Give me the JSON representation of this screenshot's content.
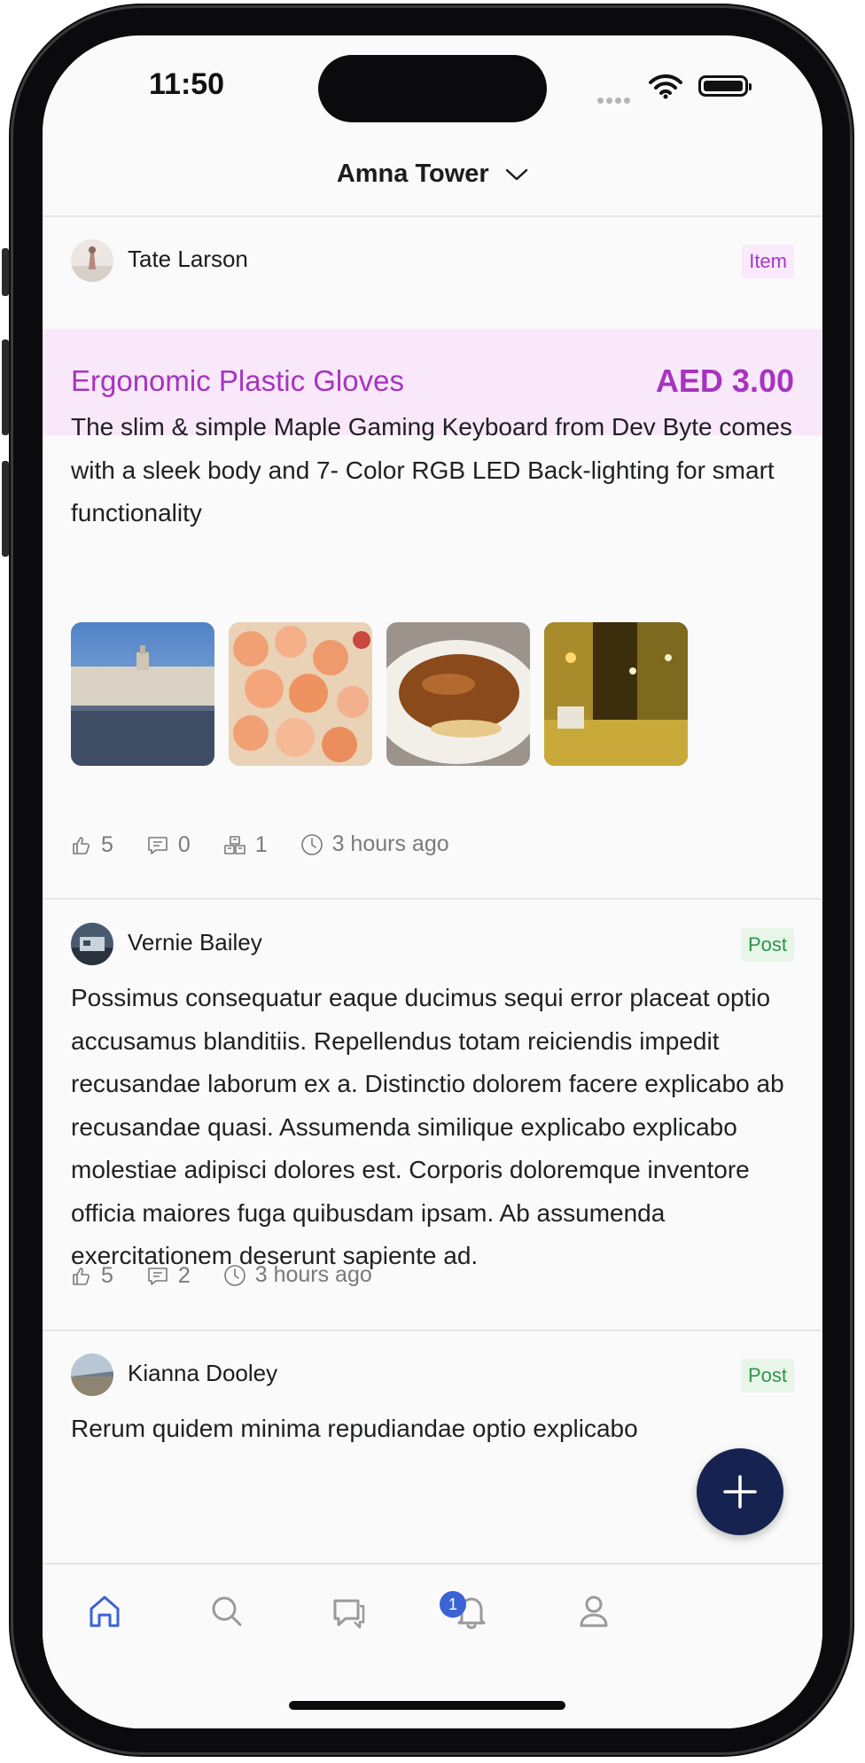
{
  "status_bar": {
    "time": "11:50"
  },
  "header": {
    "location": "Amna Tower"
  },
  "feed": [
    {
      "author": "Tate Larson",
      "type_badge": "Item",
      "item_title": "Ergonomic Plastic Gloves",
      "price": "AED 3.00",
      "body": "The slim & simple Maple Gaming Keyboard from Dev Byte comes with a sleek body and 7- Color RGB LED Back-lighting for smart functionality",
      "likes": "5",
      "comments": "0",
      "quantity": "1",
      "time": "3 hours ago",
      "images": [
        "city-square-photo",
        "roses-photo",
        "dessert-plate-photo",
        "night-street-photo"
      ]
    },
    {
      "author": "Vernie Bailey",
      "type_badge": "Post",
      "body": "Possimus consequatur eaque ducimus sequi error placeat optio accusamus blanditiis. Repellendus totam reiciendis impedit recusandae laborum ex a. Distinctio dolorem facere explicabo ab recusandae quasi. Assumenda similique explicabo explicabo molestiae adipisci dolores est. Corporis doloremque inventore officia maiores fuga quibusdam ipsam. Ab assumenda exercitationem deserunt sapiente ad.",
      "likes": "5",
      "comments": "2",
      "time": "3 hours ago"
    },
    {
      "author": "Kianna Dooley",
      "type_badge": "Post",
      "body": "Rerum quidem minima repudiandae optio explicabo"
    }
  ],
  "tabbar": {
    "items": [
      "home-icon",
      "search-icon",
      "messages-icon",
      "notifications-icon",
      "profile-icon"
    ],
    "messages_badge": "1"
  },
  "colors": {
    "accent": "#a634bf",
    "highlight_bg": "#f8e8f9",
    "post_badge": "#2e9447",
    "fab": "#16224f",
    "active_tab": "#3a63d6"
  }
}
